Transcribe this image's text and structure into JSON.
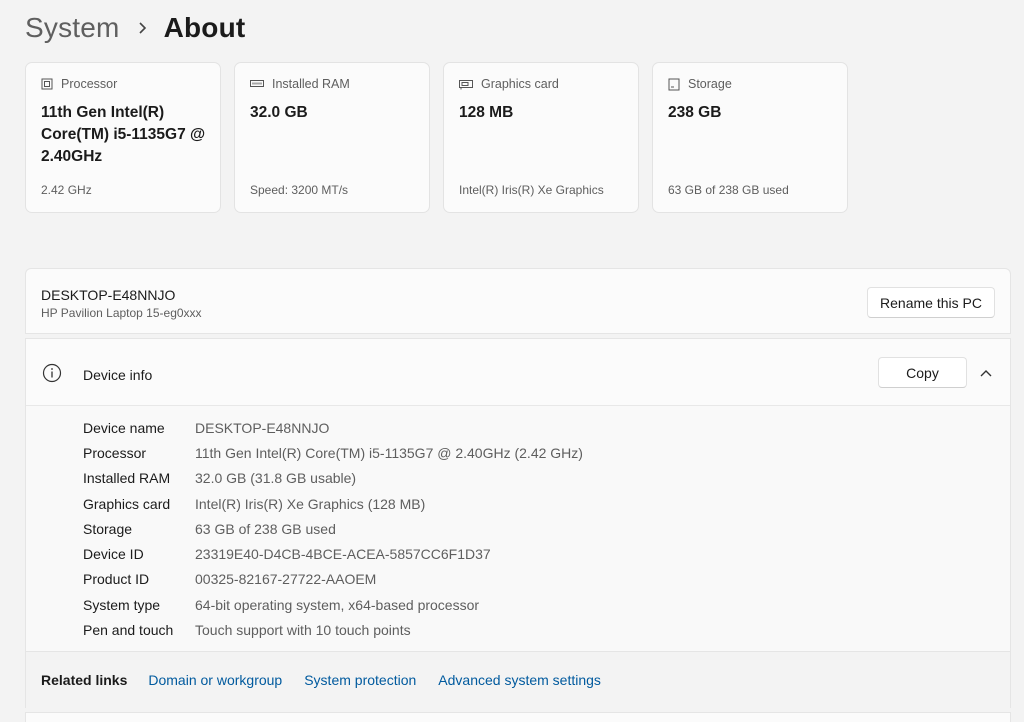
{
  "breadcrumb": {
    "parent": "System",
    "separator": "›",
    "current": "About"
  },
  "cards": [
    {
      "title": "Processor",
      "icon": "processor-icon",
      "value": "11th Gen Intel(R) Core(TM) i5-1135G7 @ 2.40GHz",
      "sub": "2.42 GHz"
    },
    {
      "title": "Installed RAM",
      "icon": "ram-icon",
      "value": "32.0 GB",
      "sub": "Speed: 3200 MT/s"
    },
    {
      "title": "Graphics card",
      "icon": "graphics-card-icon",
      "value": "128 MB",
      "sub": "Intel(R) Iris(R) Xe Graphics"
    },
    {
      "title": "Storage",
      "icon": "storage-icon",
      "value": "238 GB",
      "sub": "63 GB of 238 GB used"
    }
  ],
  "pc": {
    "name": "DESKTOP-E48NNJO",
    "model": "HP Pavilion Laptop 15-eg0xxx",
    "rename_label": "Rename this PC"
  },
  "device_info": {
    "title": "Device info",
    "copy_label": "Copy",
    "specs": [
      {
        "label": "Device name",
        "value": "DESKTOP-E48NNJO"
      },
      {
        "label": "Processor",
        "value": "11th Gen Intel(R) Core(TM) i5-1135G7 @ 2.40GHz (2.42 GHz)"
      },
      {
        "label": "Installed RAM",
        "value": "32.0 GB (31.8 GB usable)"
      },
      {
        "label": "Graphics card",
        "value": "Intel(R) Iris(R) Xe Graphics (128 MB)"
      },
      {
        "label": "Storage",
        "value": "63 GB of 238 GB used"
      },
      {
        "label": "Device ID",
        "value": "23319E40-D4CB-4BCE-ACEA-5857CC6F1D37"
      },
      {
        "label": "Product ID",
        "value": "00325-82167-27722-AAOEM"
      },
      {
        "label": "System type",
        "value": "64-bit operating system, x64-based processor"
      },
      {
        "label": "Pen and touch",
        "value": "Touch support with 10 touch points"
      }
    ]
  },
  "related": {
    "label": "Related links",
    "links": [
      "Domain or workgroup",
      "System protection",
      "Advanced system settings"
    ]
  },
  "colors": {
    "background": "#f3f3f3",
    "card": "#fbfbfb",
    "link": "#005a9e",
    "text": "#1b1b1b",
    "secondary_text": "#5e5e5e"
  }
}
